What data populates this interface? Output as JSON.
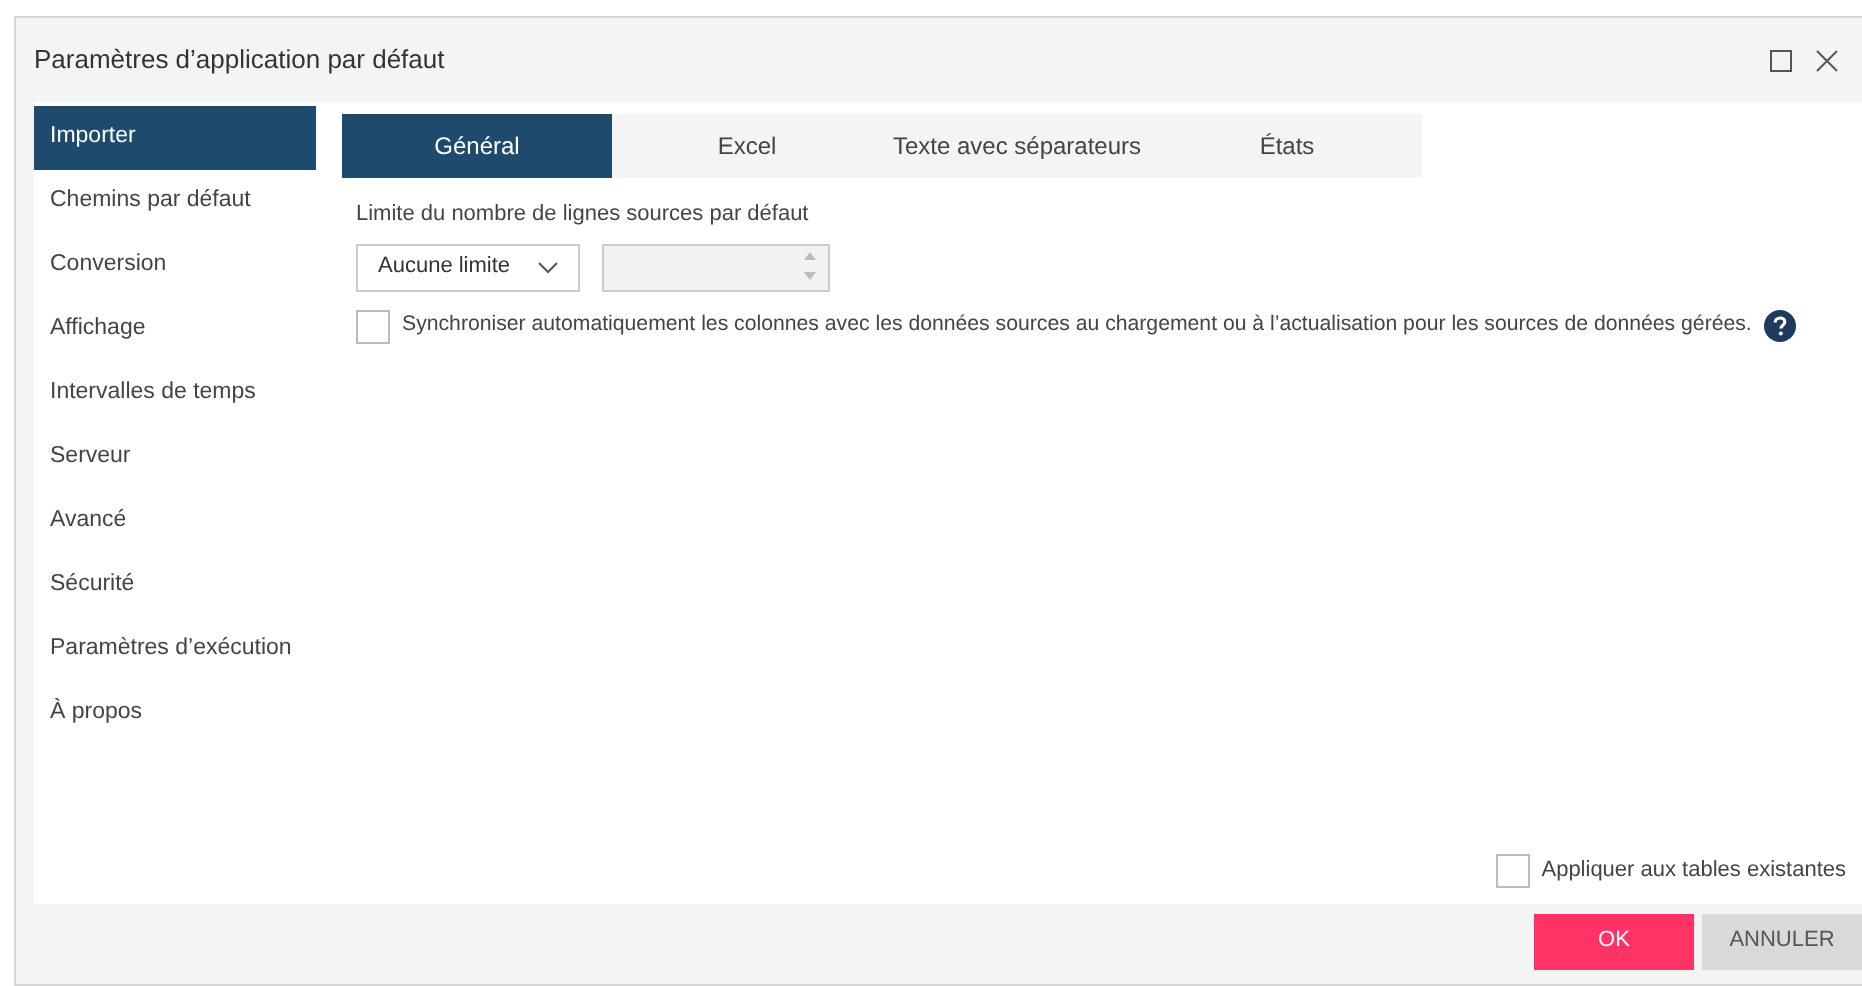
{
  "window": {
    "title": "Paramètres d’application par défaut"
  },
  "sidebar": {
    "items": [
      {
        "label": "Importer",
        "selected": true
      },
      {
        "label": "Chemins par défaut",
        "selected": false
      },
      {
        "label": "Conversion",
        "selected": false
      },
      {
        "label": "Affichage",
        "selected": false
      },
      {
        "label": "Intervalles de temps",
        "selected": false
      },
      {
        "label": "Serveur",
        "selected": false
      },
      {
        "label": "Avancé",
        "selected": false
      },
      {
        "label": "Sécurité",
        "selected": false
      },
      {
        "label": "Paramètres d’exécution",
        "selected": false
      },
      {
        "label": "À propos",
        "selected": false
      }
    ]
  },
  "tabs": [
    {
      "label": "Général",
      "selected": true
    },
    {
      "label": "Excel",
      "selected": false
    },
    {
      "label": "Texte avec séparateurs",
      "selected": false
    },
    {
      "label": "États",
      "selected": false
    }
  ],
  "row_limit": {
    "label": "Limite du nombre de lignes sources par défaut",
    "dropdown": "Aucune limite",
    "number_disabled": true
  },
  "sync_option": {
    "label": "Synchroniser automatiquement les colonnes avec les données sources au chargement ou à l’actualisation pour les sources de données gérées.",
    "checked": false
  },
  "apply_option": {
    "label": "Appliquer aux tables existantes",
    "checked": false
  },
  "buttons": [
    {
      "label": "OK",
      "kind": "primary"
    },
    {
      "label": "ANNULER",
      "kind": "secondary"
    }
  ]
}
